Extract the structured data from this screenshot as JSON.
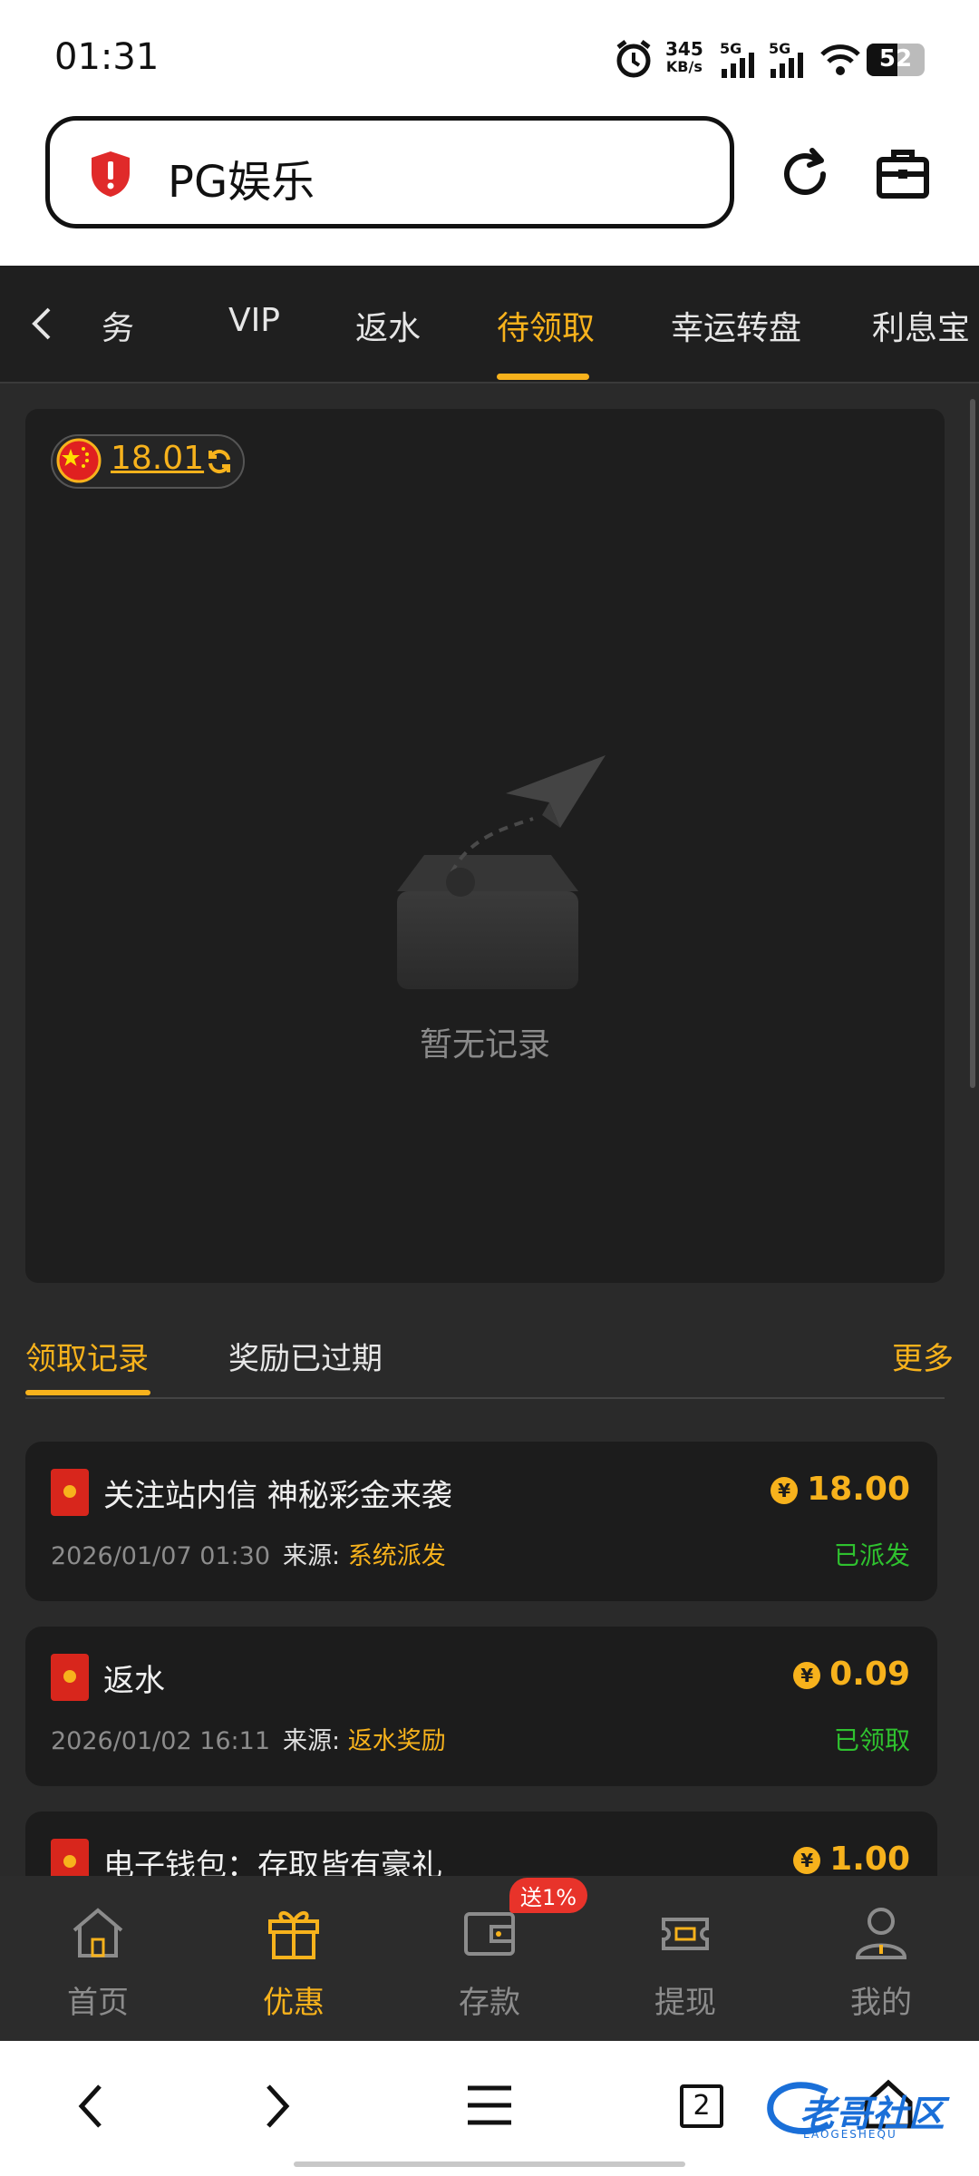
{
  "status_bar": {
    "time": "01:31",
    "net_speed_value": "345",
    "net_speed_unit": "KB/s",
    "sim1": "5G",
    "sim2": "5G",
    "battery": "52",
    "icons": [
      "alarm-icon",
      "signal-icon",
      "wifi-icon",
      "battery-icon"
    ]
  },
  "browser": {
    "url_text": "PG娱乐",
    "icons": [
      "shield-alert-icon",
      "reload-icon",
      "toolbox-icon"
    ]
  },
  "tabs": {
    "items": [
      "任务",
      "VIP",
      "返水",
      "待领取",
      "幸运转盘",
      "利息宝"
    ],
    "partial_first": "务",
    "active": "待领取"
  },
  "balance": {
    "amount": "18.01",
    "flag": "china-flag-icon"
  },
  "empty_state": {
    "text": "暂无记录"
  },
  "subtabs": {
    "items": [
      "领取记录",
      "奖励已过期"
    ],
    "active": "领取记录",
    "more": "更多"
  },
  "records": [
    {
      "title": "关注站内信 神秘彩金来袭",
      "date": "2026/01/07 01:30",
      "source_label": "来源:",
      "source": "系统派发",
      "amount": "18.00",
      "status": "已派发"
    },
    {
      "title": "返水",
      "date": "2026/01/02 16:11",
      "source_label": "来源:",
      "source": "返水奖励",
      "amount": "0.09",
      "status": "已领取"
    },
    {
      "title": "电子钱包：存取皆有豪礼",
      "amount": "1.00"
    }
  ],
  "currency_symbol": "¥",
  "bottom_nav": {
    "items": [
      {
        "label": "首页",
        "icon": "home-icon"
      },
      {
        "label": "优惠",
        "icon": "gift-icon"
      },
      {
        "label": "存款",
        "icon": "wallet-icon",
        "badge": "送1%"
      },
      {
        "label": "提现",
        "icon": "cash-icon"
      },
      {
        "label": "我的",
        "icon": "user-icon"
      }
    ],
    "active": "优惠"
  },
  "browser_nav": {
    "tab_count": "2",
    "watermark": "老哥社区",
    "watermark_sub": "LAOGESHEQU"
  },
  "colors": {
    "accent": "#f7b21c",
    "success": "#2fc22f",
    "danger": "#d8261c",
    "bg": "#2a2a2a"
  }
}
